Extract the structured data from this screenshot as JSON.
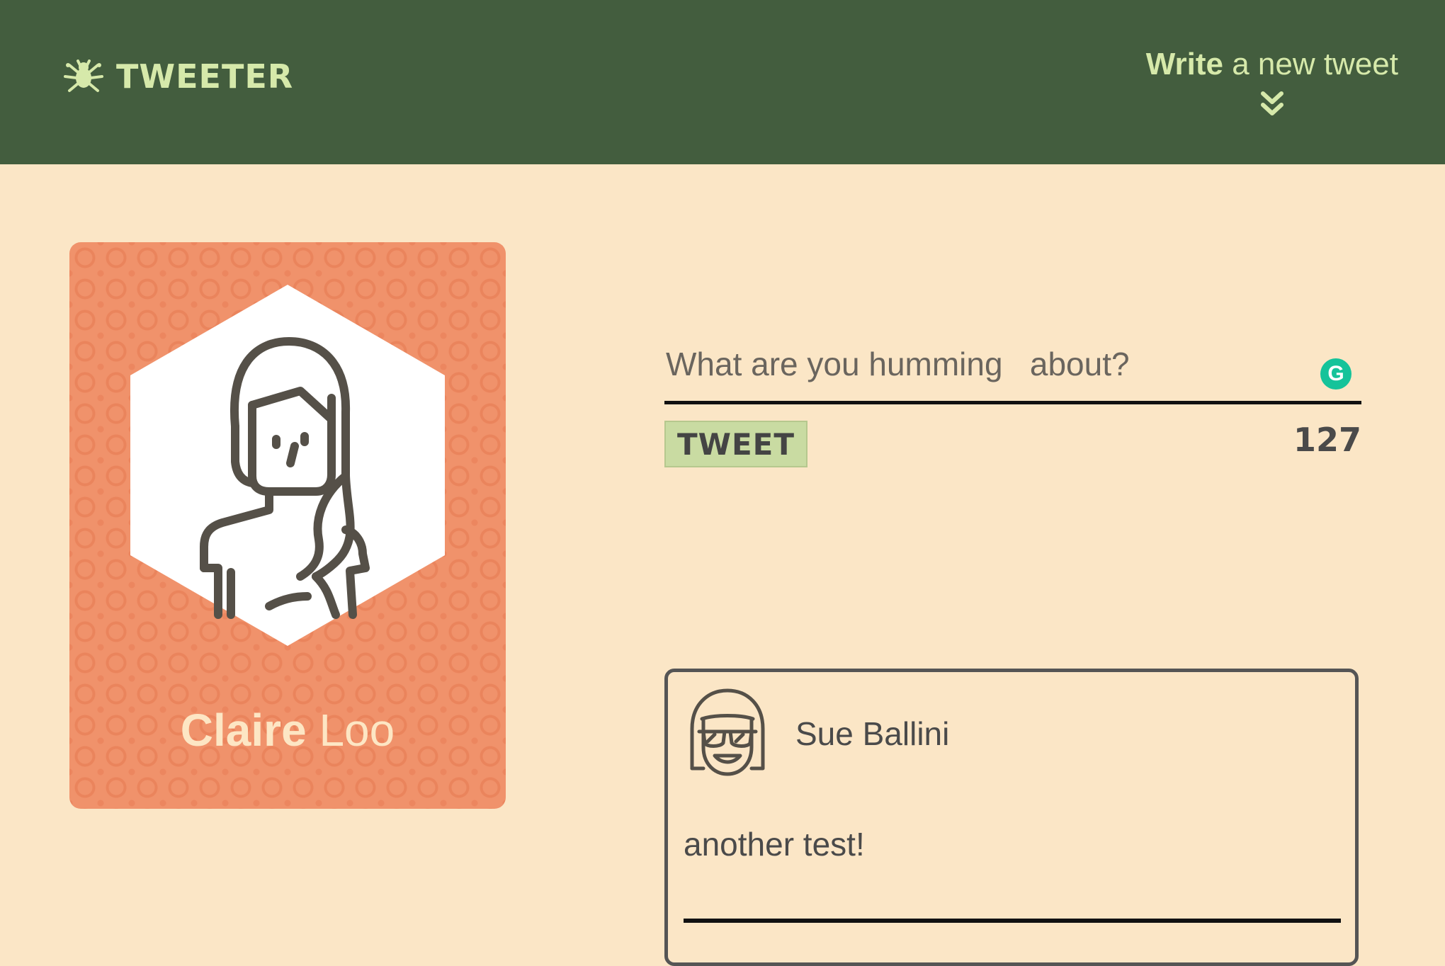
{
  "header": {
    "brand_name": "TWEETER",
    "brand_icon": "bug-icon",
    "compose_toggle": {
      "bold": "Write",
      "rest": " a new tweet",
      "icon": "double-chevron-down-icon"
    }
  },
  "profile": {
    "first_name": "Claire",
    "last_name": " Loo",
    "avatar_icon": "female-avatar-icon"
  },
  "composer": {
    "placeholder": "What are you humming   about?",
    "button_label": "TWEET",
    "char_count": "127",
    "grammarly_icon": "G"
  },
  "tweets": [
    {
      "author": "Sue Ballini",
      "body": "another test!",
      "avatar_icon": "avatar-sunglasses-icon"
    }
  ],
  "colors": {
    "header_bg": "#435d3e",
    "accent": "#d6e9aa",
    "page_bg": "#fbe6c6",
    "card_bg": "#f0926b",
    "button_bg": "#c9dba2"
  }
}
